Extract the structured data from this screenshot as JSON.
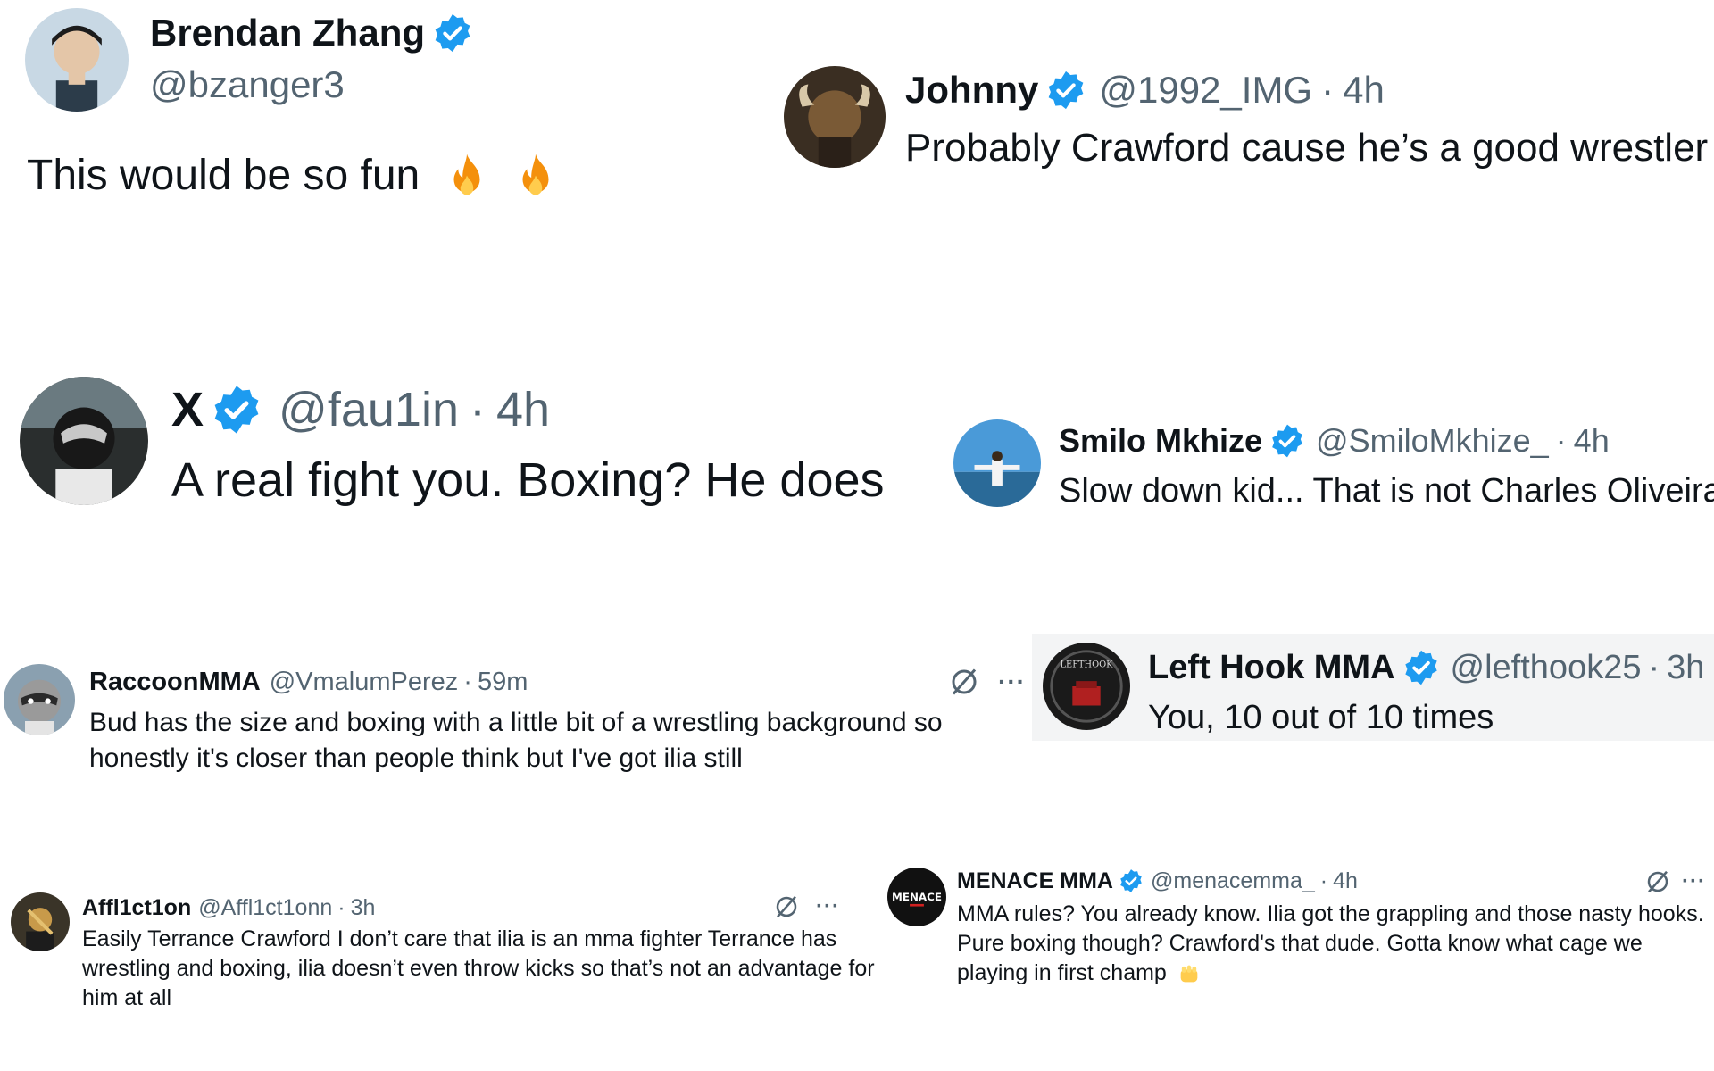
{
  "tweets": [
    {
      "name": "Brendan Zhang",
      "handle": "@bzanger3",
      "text": "This would be so fun",
      "emojis": [
        "fire-emoji",
        "fire-emoji"
      ],
      "verified": true
    },
    {
      "name": "Johnny",
      "handle": "@1992_IMG",
      "sep": "·",
      "time": "4h",
      "text": "Probably Crawford cause he’s a good wrestler",
      "verified": true
    },
    {
      "name": "X",
      "handle": "@fau1in",
      "sep": "·",
      "time": "4h",
      "text": "A real fight you. Boxing? He does",
      "verified": true
    },
    {
      "name": "Smilo Mkhize",
      "handle": "@SmiloMkhize_",
      "sep": "·",
      "time": "4h",
      "text": "Slow down kid... That is not Charles Oliveira",
      "verified": true
    },
    {
      "name": "RaccoonMMA",
      "handle": "@VmalumPerez",
      "sep": "·",
      "time": "59m",
      "text": "Bud has the size and boxing with a little bit of a wrestling background so honestly it's closer than people think but I've got ilia still",
      "verified": false,
      "more": "···"
    },
    {
      "name": "Left Hook MMA",
      "handle": "@lefthook25",
      "sep": "·",
      "time": "3h",
      "text": "You, 10 out of 10 times",
      "verified": true,
      "avatar_text": "LEFTHOOK"
    },
    {
      "name": "Affl1ct1on",
      "handle": "@Affl1ct1onn",
      "sep": "·",
      "time": "3h",
      "text": "Easily Terrance Crawford I don’t care that ilia is an mma fighter Terrance has wrestling and boxing, ilia doesn’t even throw kicks so that’s not an advantage for him at all",
      "verified": false,
      "more": "···"
    },
    {
      "name": "MENACE MMA",
      "handle": "@menacemma_",
      "sep": "·",
      "time": "4h",
      "text": "MMA rules? You already know. Ilia got the grappling and those nasty hooks. Pure boxing though? Crawford's that dude. Gotta know what cage we playing in first champ",
      "emojis": [
        "fist-emoji"
      ],
      "verified": true,
      "more": "···",
      "avatar_text": "MENACE"
    }
  ],
  "colors": {
    "verified_blue": "#1d9bf0",
    "text_primary": "#0f1419",
    "text_secondary": "#536471"
  }
}
